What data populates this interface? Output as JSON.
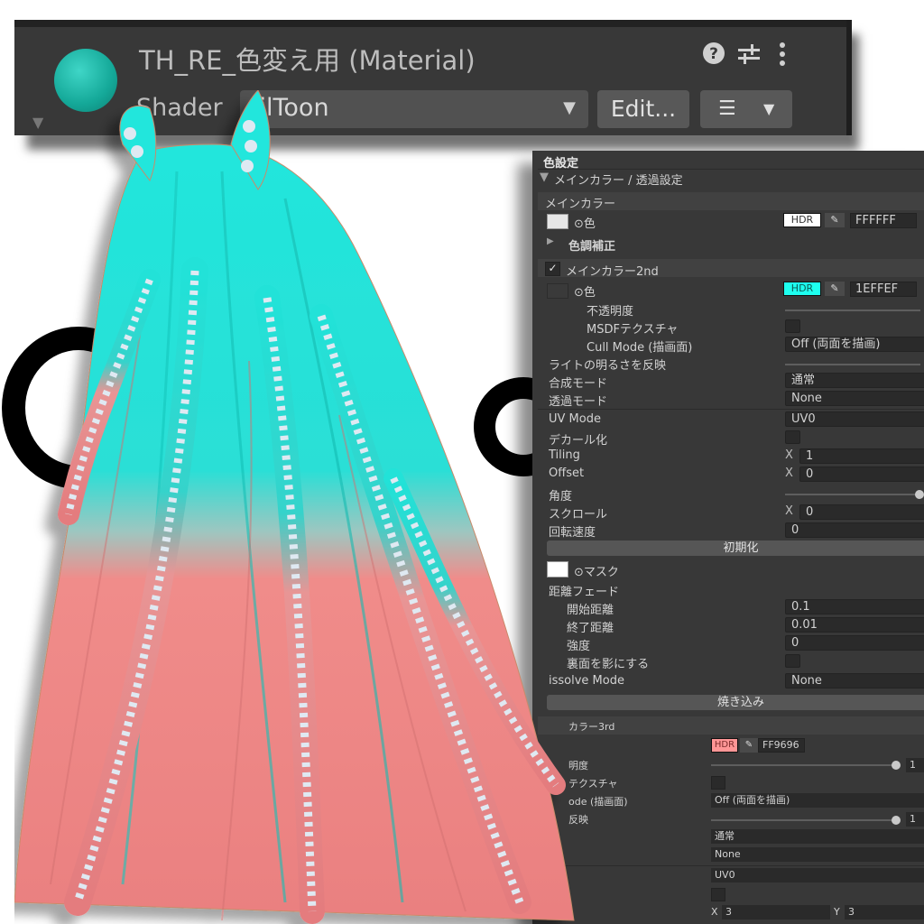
{
  "material": {
    "title": "TH_RE_色変え用 (Material)",
    "ball_color": "#16b3a4",
    "help_icon": "help-icon",
    "settings_icon": "sliders-icon",
    "menu_icon": "kebab-menu-icon",
    "shader_label": "Shader",
    "shader_value": "lilToon",
    "edit_label": "Edit...",
    "list_icon": "list-icon"
  },
  "panel": {
    "section_title": "色設定",
    "foldout_main": "メインカラー / 透過設定",
    "main_color_header": "メインカラー",
    "main_color_label": "⊙色",
    "hdr": "HDR",
    "main_color_hex": "FFFFFF",
    "main_color_swatch": "#ffffff",
    "tone_correction": "色調補正",
    "main2_header": "メインカラー2nd",
    "main2_color_label": "⊙色",
    "main2_hex": "1EFFEF",
    "main2_swatch": "#1effef",
    "opacity_label": "不透明度",
    "msdf_label": "MSDFテクスチャ",
    "cull_label": "Cull Mode (描画面)",
    "cull_value": "Off (両面を描画)",
    "light_label": "ライトの明るさを反映",
    "blend_label": "合成モード",
    "blend_value": "通常",
    "alpha_label": "透過モード",
    "alpha_value": "None",
    "uv_label": "UV Mode",
    "uv_value": "UV0",
    "decal_label": "デカール化",
    "tiling_label": "Tiling",
    "tiling_x": "1",
    "offset_label": "Offset",
    "offset_x": "0",
    "angle_label": "角度",
    "scroll_label": "スクロール",
    "scroll_x": "0",
    "rot_label": "回転速度",
    "rot_value": "0",
    "reset_label": "初期化",
    "mask_label": "⊙マスク",
    "distance_fade": "距離フェード",
    "start_dist_label": "開始距離",
    "start_dist": "0.1",
    "end_dist_label": "終了距離",
    "end_dist": "0.01",
    "strength_label": "強度",
    "strength": "0",
    "backface_label": "裏面を影にする",
    "dissolve_label": "issolve Mode",
    "dissolve_value": "None",
    "bake_label": "焼き込み",
    "main3_header": "カラー3rd",
    "main3_hex": "FF9696",
    "main3_swatch": "#ff9696",
    "opacity3_label": "明度",
    "opacity3_value": "1",
    "msdf3_label": "テクスチャ",
    "cull3_label": "ode (描画面)",
    "cull3_value": "Off (両面を描画)",
    "light3_label": "反映",
    "light3_value": "1",
    "blend3_value": "通常",
    "alpha3_value": "None",
    "uv3_value": "UV0",
    "tiling3_x": "3",
    "tiling3_y": "3",
    "x_label": "X",
    "y_label": "Y"
  },
  "character": {
    "hair_top_color": "#21e6dc",
    "hair_bottom_color": "#ee8585",
    "sucker_color": "#dfe9f2"
  }
}
